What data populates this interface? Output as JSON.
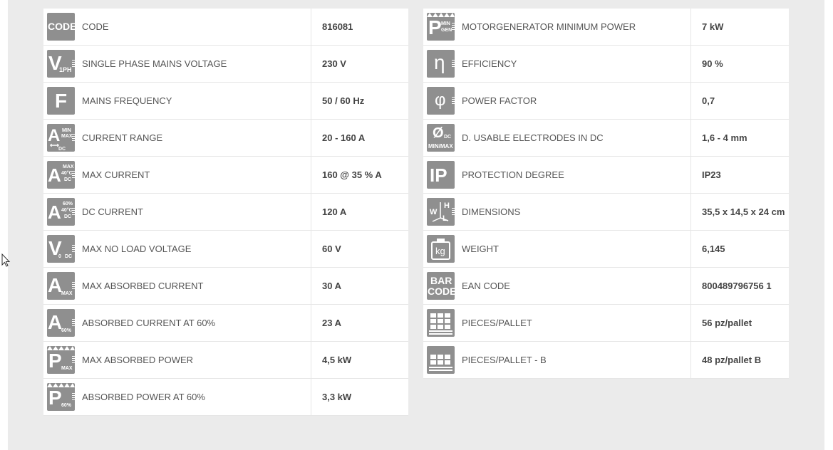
{
  "left_rows": [
    {
      "label": "CODE",
      "value": "816081",
      "icon": "code-icon"
    },
    {
      "label": "SINGLE PHASE MAINS VOLTAGE",
      "value": "230 V",
      "icon": "voltage-1ph-icon"
    },
    {
      "label": "MAINS FREQUENCY",
      "value": "50 / 60 Hz",
      "icon": "frequency-icon"
    },
    {
      "label": "CURRENT RANGE",
      "value": "20 - 160 A",
      "icon": "current-range-icon"
    },
    {
      "label": "MAX CURRENT",
      "value": "160 @ 35 % A",
      "icon": "max-current-icon"
    },
    {
      "label": "DC CURRENT",
      "value": "120 A",
      "icon": "dc-current-icon"
    },
    {
      "label": "MAX NO LOAD VOLTAGE",
      "value": "60 V",
      "icon": "no-load-voltage-icon"
    },
    {
      "label": "MAX ABSORBED CURRENT",
      "value": "30 A",
      "icon": "max-absorbed-current-icon"
    },
    {
      "label": "ABSORBED CURRENT AT 60%",
      "value": "23 A",
      "icon": "absorbed-current-60-icon"
    },
    {
      "label": "MAX ABSORBED POWER",
      "value": "4,5 kW",
      "icon": "max-absorbed-power-icon"
    },
    {
      "label": "ABSORBED POWER AT 60%",
      "value": "3,3 kW",
      "icon": "absorbed-power-60-icon"
    }
  ],
  "right_rows": [
    {
      "label": "MOTORGENERATOR MINIMUM POWER",
      "value": "7 kW",
      "icon": "motorgenerator-icon"
    },
    {
      "label": "EFFICIENCY",
      "value": "90 %",
      "icon": "efficiency-icon"
    },
    {
      "label": "POWER FACTOR",
      "value": "0,7",
      "icon": "power-factor-icon"
    },
    {
      "label": "D. USABLE ELECTRODES IN DC",
      "value": "1,6 - 4 mm",
      "icon": "electrode-diameter-icon"
    },
    {
      "label": "PROTECTION DEGREE",
      "value": "IP23",
      "icon": "protection-degree-icon"
    },
    {
      "label": "DIMENSIONS",
      "value": "35,5 x 14,5 x 24 cm",
      "icon": "dimensions-icon"
    },
    {
      "label": "WEIGHT",
      "value": "6,145",
      "icon": "weight-icon"
    },
    {
      "label": "EAN CODE",
      "value": "800489796756 1",
      "icon": "barcode-icon"
    },
    {
      "label": "PIECES/PALLET",
      "value": "56 pz/pallet",
      "icon": "pallet-icon"
    },
    {
      "label": "PIECES/PALLET - B",
      "value": "48 pz/pallet B",
      "icon": "pallet-b-icon"
    }
  ],
  "icon_text": {
    "code": "CODE",
    "v": "V",
    "onePh": "1PH",
    "f": "F",
    "a": "A",
    "min": "MIN",
    "max": "MAX",
    "dc": "DC",
    "t40": "40°C",
    "p60": "60%",
    "v0": "0",
    "p": "P",
    "gen": "GEN",
    "eta": "η",
    "phi": "φ",
    "diam": "Ø",
    "minmax": "MIN/MAX",
    "ip": "IP",
    "w": "W",
    "h": "H",
    "l": "L",
    "kg": "kg",
    "bar": "BAR"
  },
  "colors": {
    "panel": "#ebebeb",
    "icon": "#8f8f8f",
    "value": "#444444",
    "label": "#555555"
  }
}
